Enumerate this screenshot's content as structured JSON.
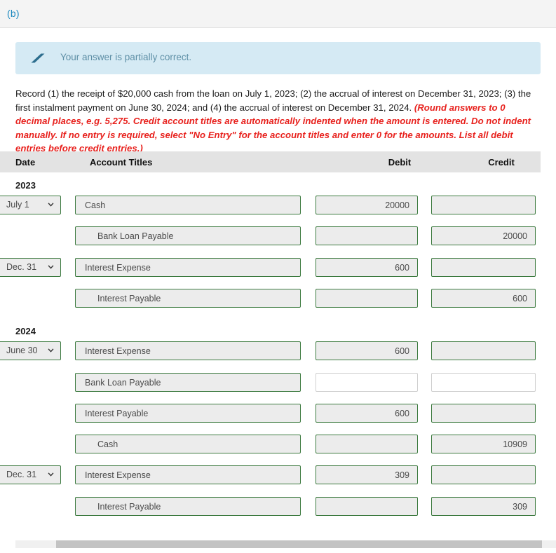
{
  "part": {
    "label": "(b)"
  },
  "banner": {
    "icon": "eraser-icon",
    "message": "Your answer is partially correct.",
    "background_color": "#d5eaf4",
    "text_color": "#5e8fa6"
  },
  "instructions": {
    "normal_text": "Record (1) the receipt of $20,000 cash from the loan on July 1, 2023; (2) the accrual of interest on December 31, 2023; (3) the first instalment payment on June 30, 2024; and (4) the accrual of interest on December 31, 2024. ",
    "emphasis_text": "(Round answers to 0 decimal places, e.g. 5,275. Credit account titles are automatically indented when the amount is entered. Do not indent manually. If no entry is required, select \"No Entry\" for the account titles and enter 0 for the amounts. List all debit entries before credit entries.)",
    "emphasis_color": "#e8221e"
  },
  "journal": {
    "columns": {
      "date": "Date",
      "account_titles": "Account Titles",
      "debit": "Debit",
      "credit": "Credit"
    },
    "header_background": "#e3e3e3",
    "field_border_filled": "#3c7a3f",
    "field_background_filled": "#ececec",
    "field_border_blank": "#cfcfcf",
    "sections": [
      {
        "year": "2023",
        "rows": [
          {
            "date": "July 1",
            "has_date": true,
            "account": "Cash",
            "indented": false,
            "debit": "20000",
            "credit": "",
            "debit_state": "filled",
            "credit_state": "filled"
          },
          {
            "date": "",
            "has_date": false,
            "account": "Bank Loan Payable",
            "indented": true,
            "debit": "",
            "credit": "20000",
            "debit_state": "filled",
            "credit_state": "filled"
          },
          {
            "date": "Dec. 31",
            "has_date": true,
            "account": "Interest Expense",
            "indented": false,
            "debit": "600",
            "credit": "",
            "debit_state": "filled",
            "credit_state": "filled"
          },
          {
            "date": "",
            "has_date": false,
            "account": "Interest Payable",
            "indented": true,
            "debit": "",
            "credit": "600",
            "debit_state": "filled",
            "credit_state": "filled"
          }
        ]
      },
      {
        "year": "2024",
        "rows": [
          {
            "date": "June 30",
            "has_date": true,
            "account": "Interest Expense",
            "indented": false,
            "debit": "600",
            "credit": "",
            "debit_state": "filled",
            "credit_state": "filled"
          },
          {
            "date": "",
            "has_date": false,
            "account": "Bank Loan Payable",
            "indented": false,
            "debit": "",
            "credit": "",
            "debit_state": "blank",
            "credit_state": "blank"
          },
          {
            "date": "",
            "has_date": false,
            "account": "Interest Payable",
            "indented": false,
            "debit": "600",
            "credit": "",
            "debit_state": "filled",
            "credit_state": "filled"
          },
          {
            "date": "",
            "has_date": false,
            "account": "Cash",
            "indented": true,
            "debit": "",
            "credit": "10909",
            "debit_state": "filled",
            "credit_state": "filled"
          },
          {
            "date": "Dec. 31",
            "has_date": true,
            "account": "Interest Expense",
            "indented": false,
            "debit": "309",
            "credit": "",
            "debit_state": "filled",
            "credit_state": "filled"
          },
          {
            "date": "",
            "has_date": false,
            "account": "Interest Payable",
            "indented": true,
            "debit": "",
            "credit": "309",
            "debit_state": "filled",
            "credit_state": "filled"
          }
        ]
      }
    ]
  },
  "scrollbar": {
    "orientation": "horizontal"
  }
}
